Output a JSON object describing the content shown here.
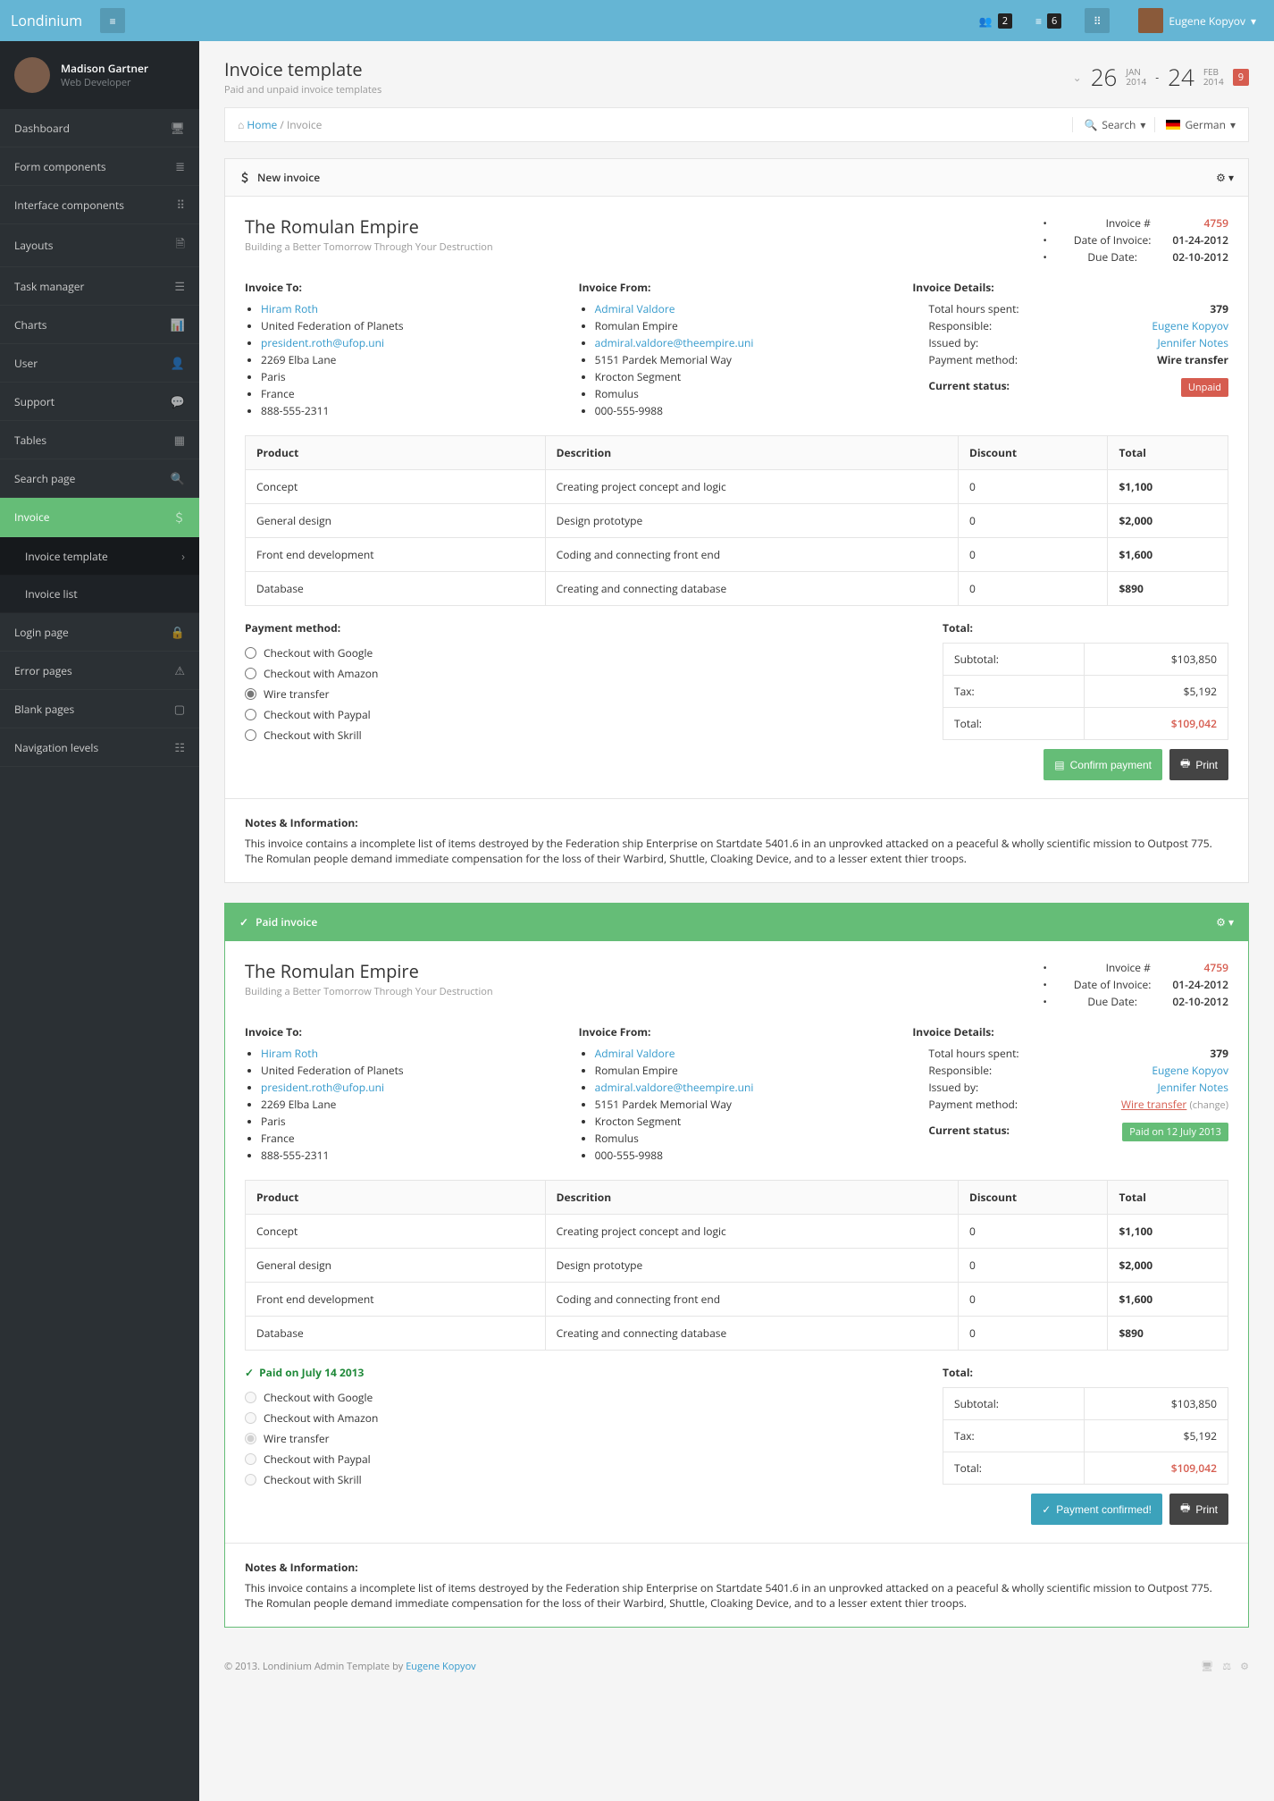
{
  "app": {
    "name": "Londinium",
    "topCounts": {
      "people": "2",
      "list": "6"
    },
    "user": "Eugene Kopyov"
  },
  "sidebarUser": {
    "name": "Madison Gartner",
    "role": "Web Developer"
  },
  "nav": {
    "dashboard": "Dashboard",
    "forms": "Form components",
    "interface": "Interface components",
    "layouts": "Layouts",
    "task": "Task manager",
    "charts": "Charts",
    "user": "User",
    "support": "Support",
    "tables": "Tables",
    "search": "Search page",
    "invoice": "Invoice",
    "invoiceTemplate": "Invoice template",
    "invoiceList": "Invoice list",
    "login": "Login page",
    "error": "Error pages",
    "blank": "Blank pages",
    "navlev": "Navigation levels"
  },
  "page": {
    "title": "Invoice template",
    "subtitle": "Paid and unpaid invoice templates",
    "dateFrom": {
      "d": "26",
      "m": "JAN",
      "y": "2014"
    },
    "dateTo": {
      "d": "24",
      "m": "FEB",
      "y": "2014"
    },
    "badge": "9",
    "crumbHome": "Home",
    "crumbCurrent": "Invoice",
    "search": "Search",
    "lang": "German"
  },
  "invoice": {
    "newTitle": "New invoice",
    "paidTitle": "Paid invoice",
    "company": "The Romulan Empire",
    "slogan": "Building a Better Tomorrow Through Your Destruction",
    "meta": {
      "numLabel": "Invoice #",
      "num": "4759",
      "dateLabel": "Date of Invoice:",
      "date": "01-24-2012",
      "dueLabel": "Due Date:",
      "due": "02-10-2012"
    },
    "toLabel": "Invoice To:",
    "fromLabel": "Invoice From:",
    "detailsLabel": "Invoice Details:",
    "to": {
      "name": "Hiram Roth",
      "org": "United Federation of Planets",
      "email": "president.roth@ufop.uni",
      "addr": "2269 Elba Lane",
      "city": "Paris",
      "country": "France",
      "phone": "888-555-2311"
    },
    "from": {
      "name": "Admiral Valdore",
      "org": "Romulan Empire",
      "email": "admiral.valdore@theempire.uni",
      "addr": "5151 Pardek Memorial Way",
      "city": "Krocton Segment",
      "country": "Romulus",
      "phone": "000-555-9988"
    },
    "details": {
      "hoursLabel": "Total hours spent:",
      "hours": "379",
      "respLabel": "Responsible:",
      "resp": "Eugene Kopyov",
      "issuedLabel": "Issued by:",
      "issued": "Jennifer Notes",
      "pmLabel": "Payment method:",
      "pm": "Wire transfer",
      "statusLabel": "Current status:",
      "statusUnpaid": "Unpaid",
      "statusPaid": "Paid on 12 July 2013",
      "change": "(change)"
    },
    "cols": {
      "product": "Product",
      "desc": "Descrition",
      "discount": "Discount",
      "total": "Total"
    },
    "items": [
      {
        "p": "Concept",
        "d": "Creating project concept and logic",
        "disc": "0",
        "t": "$1,100"
      },
      {
        "p": "General design",
        "d": "Design prototype",
        "disc": "0",
        "t": "$2,000"
      },
      {
        "p": "Front end development",
        "d": "Coding and connecting front end",
        "disc": "0",
        "t": "$1,600"
      },
      {
        "p": "Database",
        "d": "Creating and connecting database",
        "disc": "0",
        "t": "$890"
      }
    ],
    "payLabel": "Payment method:",
    "payOptions": [
      "Checkout with Google",
      "Checkout with Amazon",
      "Wire transfer",
      "Checkout with Paypal",
      "Checkout with Skrill"
    ],
    "paidMark": "Paid on July 14 2013",
    "totalsLabel": "Total:",
    "totals": {
      "subLabel": "Subtotal:",
      "sub": "$103,850",
      "taxLabel": "Tax:",
      "tax": "$5,192",
      "totLabel": "Total:",
      "tot": "$109,042"
    },
    "btnConfirm": "Confirm payment",
    "btnConfirmed": "Payment confirmed!",
    "btnPrint": "Print",
    "notesLabel": "Notes & Information:",
    "notesText": "This invoice contains a incomplete list of items destroyed by the Federation ship Enterprise on Startdate 5401.6 in an unprovked attacked on a peaceful & wholly scientific mission to Outpost 775. The Romulan people demand immediate compensation for the loss of their Warbird, Shuttle, Cloaking Device, and to a lesser extent thier troops."
  },
  "footer": {
    "text": "© 2013. Londinium Admin Template by ",
    "author": "Eugene Kopyov"
  }
}
